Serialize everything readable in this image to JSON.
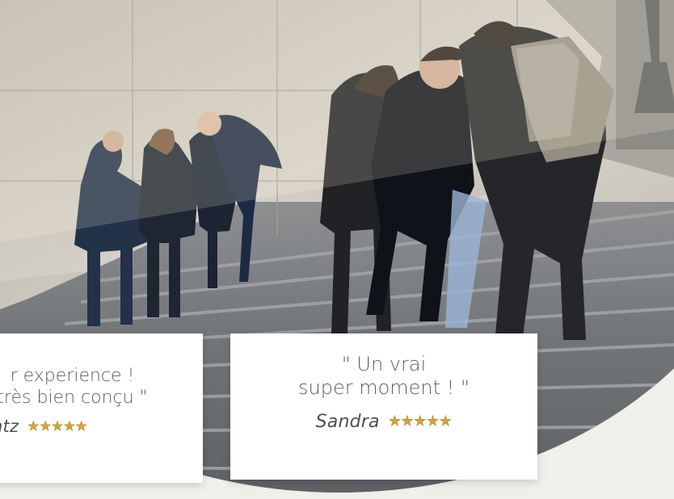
{
  "reviews": [
    {
      "quote": "r experience !\ntrès bien conçu \"",
      "author": "ntz",
      "stars": "★★★★★"
    },
    {
      "quote": "\" Un vrai\nsuper moment ! \"",
      "author": "Sandra",
      "stars": "★★★★★"
    }
  ],
  "photo": {
    "icon": "group-on-stairs-photo",
    "colors": {
      "wall": "#c9c4ba",
      "stairs": "#777a7d",
      "shadow": "#4d5256",
      "star": "#d6a436"
    }
  }
}
